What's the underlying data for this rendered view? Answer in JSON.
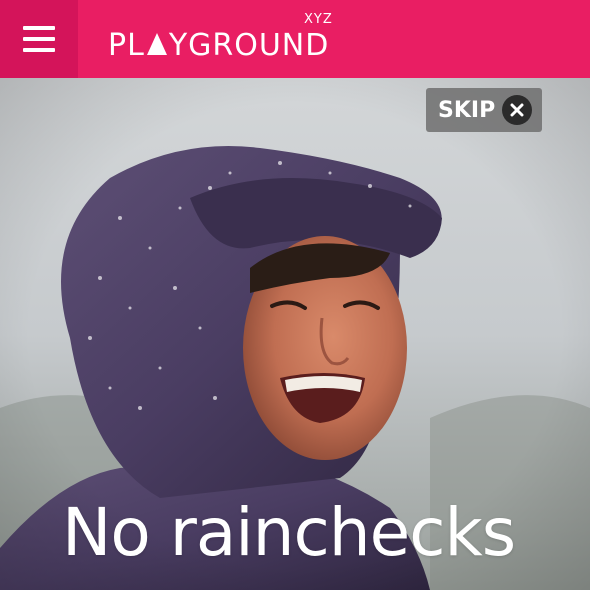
{
  "header": {
    "menu_icon": "hamburger-menu-icon",
    "logo_text_before": "PL",
    "logo_text_after": "YGROUND",
    "logo_superscript": "XYZ",
    "brand_color": "#e91e63",
    "menu_bg_color": "#d4145a"
  },
  "skip": {
    "label": "SKIP",
    "icon": "close-icon"
  },
  "hero": {
    "headline": "No rainchecks",
    "image_subject": "smiling woman in purple rain hood"
  }
}
